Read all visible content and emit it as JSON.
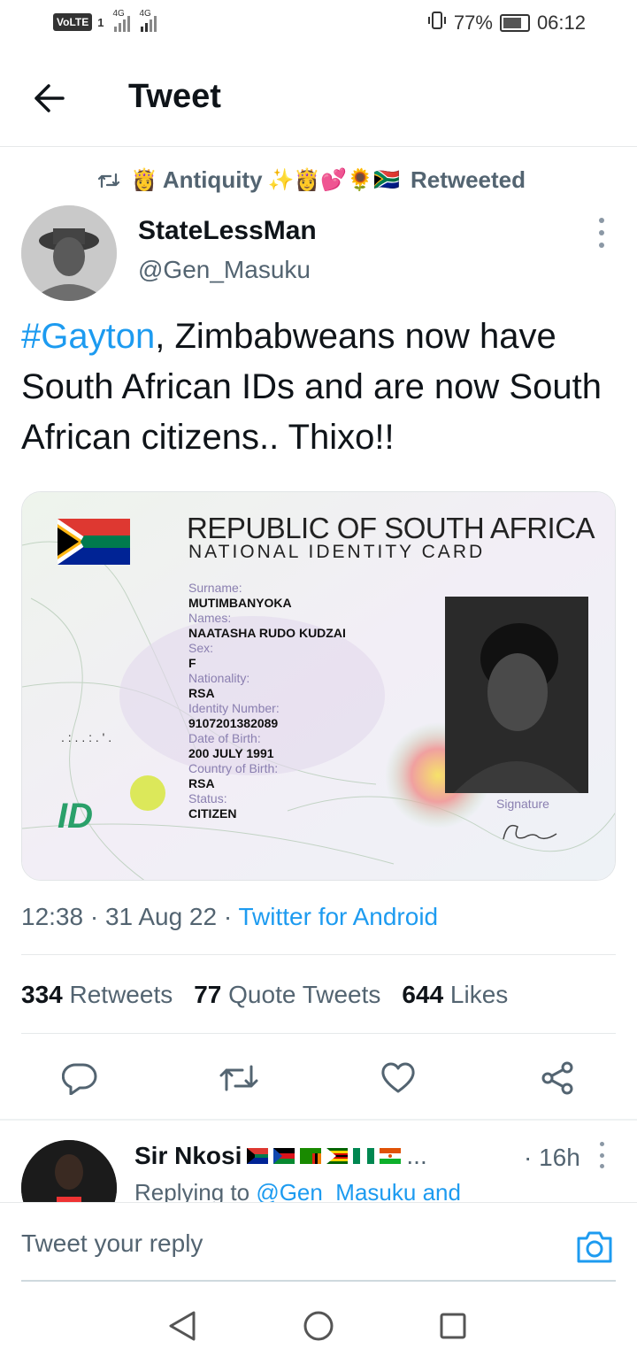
{
  "status_bar": {
    "volte": "VoLTE",
    "sim": "1",
    "net1": "4G",
    "net2": "4G",
    "battery": "77%",
    "time": "06:12"
  },
  "header": {
    "title": "Tweet",
    "back_icon": "arrow-left-icon"
  },
  "retweet": {
    "icon": "retweet-icon",
    "user": "Antiquity",
    "emoji_before": "👸",
    "emoji_after": "✨👸💕🌻🇿🇦",
    "label": "Retweeted"
  },
  "tweet": {
    "display_name": "StateLessMan",
    "handle": "@Gen_Masuku",
    "hashtag": "#Gayton",
    "text": ", Zimbabweans now have South African IDs and are now South African citizens.. Thixo!!",
    "timestamp": "12:38 · 31 Aug 22 · ",
    "source": "Twitter for Android"
  },
  "id_card": {
    "title": "REPUBLIC OF SOUTH AFRICA",
    "subtitle": "NATIONAL IDENTITY CARD",
    "fields": [
      {
        "label": "Surname:",
        "value": "MUTIMBANYOKA"
      },
      {
        "label": "Names:",
        "value": "NAATASHA RUDO KUDZAI"
      },
      {
        "label": "Sex:",
        "value": "F"
      },
      {
        "label": "Nationality:",
        "value": "RSA"
      },
      {
        "label": "Identity Number:",
        "value": "9107201382089"
      },
      {
        "label": "Date of Birth:",
        "value": "200 JULY 1991"
      },
      {
        "label": "Country of Birth:",
        "value": "RSA"
      },
      {
        "label": "Status:",
        "value": "CITIZEN"
      }
    ],
    "signature_label": "Signature",
    "logo": "ID"
  },
  "stats": {
    "retweets_count": "334",
    "retweets_label": "Retweets",
    "quotes_count": "77",
    "quotes_label": "Quote Tweets",
    "likes_count": "644",
    "likes_label": "Likes"
  },
  "actions": [
    "reply-icon",
    "retweet-icon",
    "like-icon",
    "share-icon"
  ],
  "reply": {
    "name": "Sir Nkosi",
    "flags_suffix": "...",
    "time": "· 16h",
    "replying_prefix": "Replying to ",
    "replying_to": "@Gen_Masuku and"
  },
  "compose": {
    "placeholder": "Tweet your reply"
  },
  "colors": {
    "accent": "#1d9bf0",
    "muted": "#536471",
    "text": "#0f1419"
  }
}
